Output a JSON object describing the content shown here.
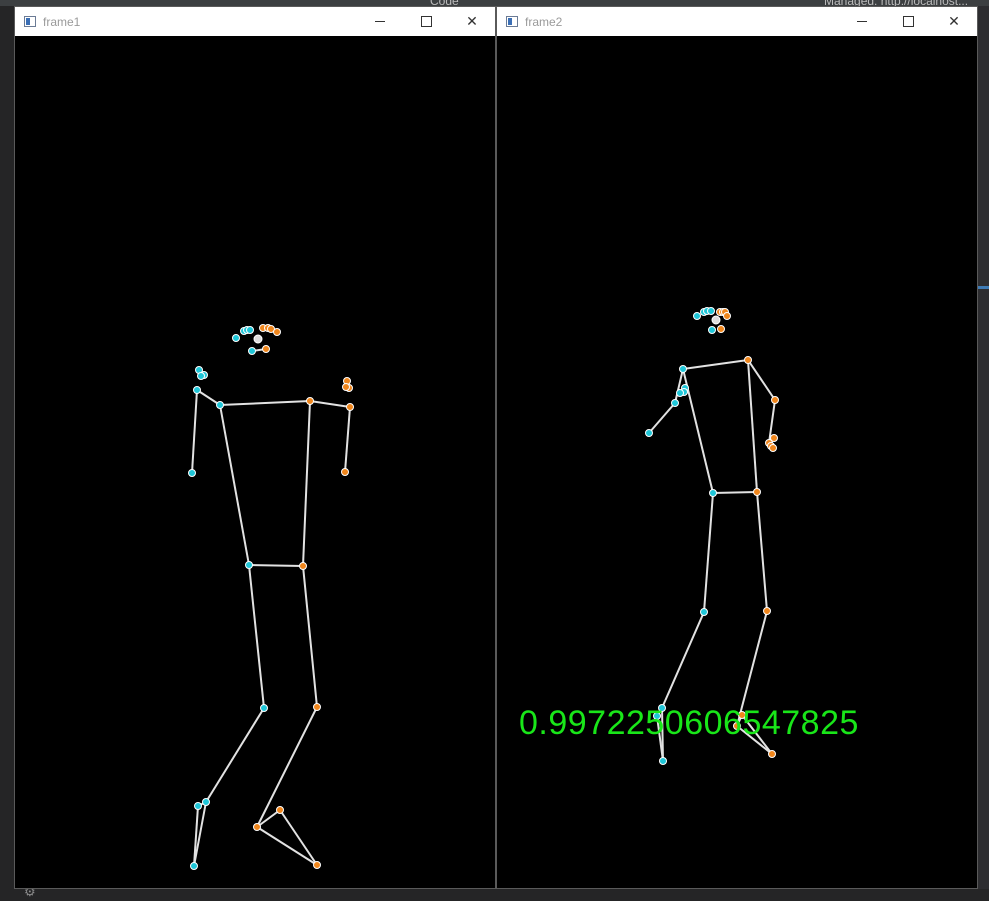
{
  "background": {
    "top_left_text": "Code",
    "top_right_text": "Managed: http://localhost..."
  },
  "windows": [
    {
      "title": "frame1",
      "controls": {
        "minimize": "minimize-icon",
        "maximize": "maximize-icon",
        "close": "close-icon"
      }
    },
    {
      "title": "frame2",
      "score_text": "0.9972250606547825",
      "controls": {
        "minimize": "minimize-icon",
        "maximize": "maximize-icon",
        "close": "close-icon"
      }
    }
  ],
  "colors": {
    "left_joint": "#1fc6d8",
    "right_joint": "#f0861c",
    "bone": "#e2e2e2",
    "nose": "#dddddd",
    "score": "#19e619"
  }
}
